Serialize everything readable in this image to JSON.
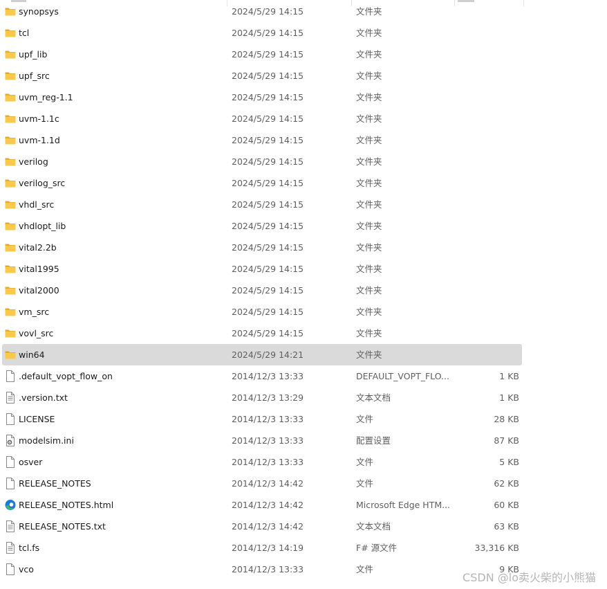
{
  "rows": [
    {
      "name": "synopsys",
      "date": "2024/5/29 14:15",
      "type": "文件夹",
      "size": "",
      "icon": "folder-icon",
      "selected": false
    },
    {
      "name": "tcl",
      "date": "2024/5/29 14:15",
      "type": "文件夹",
      "size": "",
      "icon": "folder-icon",
      "selected": false
    },
    {
      "name": "upf_lib",
      "date": "2024/5/29 14:15",
      "type": "文件夹",
      "size": "",
      "icon": "folder-icon",
      "selected": false
    },
    {
      "name": "upf_src",
      "date": "2024/5/29 14:15",
      "type": "文件夹",
      "size": "",
      "icon": "folder-icon",
      "selected": false
    },
    {
      "name": "uvm_reg-1.1",
      "date": "2024/5/29 14:15",
      "type": "文件夹",
      "size": "",
      "icon": "folder-icon",
      "selected": false
    },
    {
      "name": "uvm-1.1c",
      "date": "2024/5/29 14:15",
      "type": "文件夹",
      "size": "",
      "icon": "folder-icon",
      "selected": false
    },
    {
      "name": "uvm-1.1d",
      "date": "2024/5/29 14:15",
      "type": "文件夹",
      "size": "",
      "icon": "folder-icon",
      "selected": false
    },
    {
      "name": "verilog",
      "date": "2024/5/29 14:15",
      "type": "文件夹",
      "size": "",
      "icon": "folder-icon",
      "selected": false
    },
    {
      "name": "verilog_src",
      "date": "2024/5/29 14:15",
      "type": "文件夹",
      "size": "",
      "icon": "folder-icon",
      "selected": false
    },
    {
      "name": "vhdl_src",
      "date": "2024/5/29 14:15",
      "type": "文件夹",
      "size": "",
      "icon": "folder-icon",
      "selected": false
    },
    {
      "name": "vhdlopt_lib",
      "date": "2024/5/29 14:15",
      "type": "文件夹",
      "size": "",
      "icon": "folder-icon",
      "selected": false
    },
    {
      "name": "vital2.2b",
      "date": "2024/5/29 14:15",
      "type": "文件夹",
      "size": "",
      "icon": "folder-icon",
      "selected": false
    },
    {
      "name": "vital1995",
      "date": "2024/5/29 14:15",
      "type": "文件夹",
      "size": "",
      "icon": "folder-icon",
      "selected": false
    },
    {
      "name": "vital2000",
      "date": "2024/5/29 14:15",
      "type": "文件夹",
      "size": "",
      "icon": "folder-icon",
      "selected": false
    },
    {
      "name": "vm_src",
      "date": "2024/5/29 14:15",
      "type": "文件夹",
      "size": "",
      "icon": "folder-icon",
      "selected": false
    },
    {
      "name": "vovl_src",
      "date": "2024/5/29 14:15",
      "type": "文件夹",
      "size": "",
      "icon": "folder-icon",
      "selected": false
    },
    {
      "name": "win64",
      "date": "2024/5/29 14:21",
      "type": "文件夹",
      "size": "",
      "icon": "folder-icon",
      "selected": true
    },
    {
      "name": ".default_vopt_flow_on",
      "date": "2014/12/3 13:33",
      "type": "DEFAULT_VOPT_FLO...",
      "size": "1 KB",
      "icon": "blank-file-icon",
      "selected": false
    },
    {
      "name": ".version.txt",
      "date": "2014/12/3 13:29",
      "type": "文本文档",
      "size": "1 KB",
      "icon": "text-file-icon",
      "selected": false
    },
    {
      "name": "LICENSE",
      "date": "2014/12/3 13:33",
      "type": "文件",
      "size": "28 KB",
      "icon": "blank-file-icon",
      "selected": false
    },
    {
      "name": "modelsim.ini",
      "date": "2014/12/3 13:33",
      "type": "配置设置",
      "size": "87 KB",
      "icon": "settings-file-icon",
      "selected": false
    },
    {
      "name": "osver",
      "date": "2014/12/3 13:33",
      "type": "文件",
      "size": "5 KB",
      "icon": "blank-file-icon",
      "selected": false
    },
    {
      "name": "RELEASE_NOTES",
      "date": "2014/12/3 14:42",
      "type": "文件",
      "size": "62 KB",
      "icon": "blank-file-icon",
      "selected": false
    },
    {
      "name": "RELEASE_NOTES.html",
      "date": "2014/12/3 14:42",
      "type": "Microsoft Edge HTM...",
      "size": "60 KB",
      "icon": "edge-icon",
      "selected": false
    },
    {
      "name": "RELEASE_NOTES.txt",
      "date": "2014/12/3 14:42",
      "type": "文本文档",
      "size": "63 KB",
      "icon": "text-file-icon",
      "selected": false
    },
    {
      "name": "tcl.fs",
      "date": "2014/12/3 14:19",
      "type": "F# 源文件",
      "size": "33,316 KB",
      "icon": "text-file-icon",
      "selected": false
    },
    {
      "name": "vco",
      "date": "2014/12/3 13:33",
      "type": "文件",
      "size": "9 KB",
      "icon": "blank-file-icon",
      "selected": false
    }
  ],
  "watermark": "CSDN @lo卖火柴的小熊猫",
  "colors": {
    "folder": "#f6c344",
    "selected_row": "#dadada",
    "edge_blue": "#1c7bd4",
    "edge_green": "#3fbf5a"
  }
}
